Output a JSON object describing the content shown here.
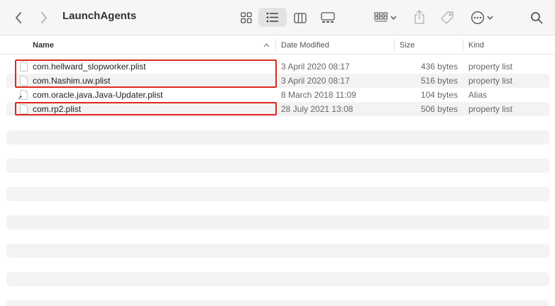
{
  "window": {
    "title": "LaunchAgents"
  },
  "toolbar": {
    "back_icon": "chevron-left",
    "forward_icon": "chevron-right",
    "view_icons": [
      "grid-view",
      "list-view",
      "column-view",
      "gallery-view"
    ],
    "active_view": "list-view",
    "group_icon": "group-by",
    "share_icon": "share",
    "tag_icon": "tag",
    "more_icon": "ellipsis-circle",
    "search_icon": "magnifying-glass"
  },
  "columns": {
    "name": "Name",
    "date": "Date Modified",
    "size": "Size",
    "kind": "Kind"
  },
  "files": [
    {
      "name": "com.hellward_slopworker.plist",
      "date": "3 April 2020 08:17",
      "size": "436 bytes",
      "kind": "property list",
      "highlighted": true
    },
    {
      "name": "com.Nashim.uw.plist",
      "date": "3 April 2020 08:17",
      "size": "516 bytes",
      "kind": "property list",
      "highlighted": true
    },
    {
      "name": "com.oracle.java.Java-Updater.plist",
      "date": "8 March 2018 11:09",
      "size": "104 bytes",
      "kind": "Alias",
      "highlighted": false
    },
    {
      "name": "com.rp2.plist",
      "date": "28 July 2021 13:08",
      "size": "506 bytes",
      "kind": "property list",
      "highlighted": true
    }
  ],
  "colors": {
    "annotation": "#e0271c",
    "stripe": "#f3f3f3"
  }
}
